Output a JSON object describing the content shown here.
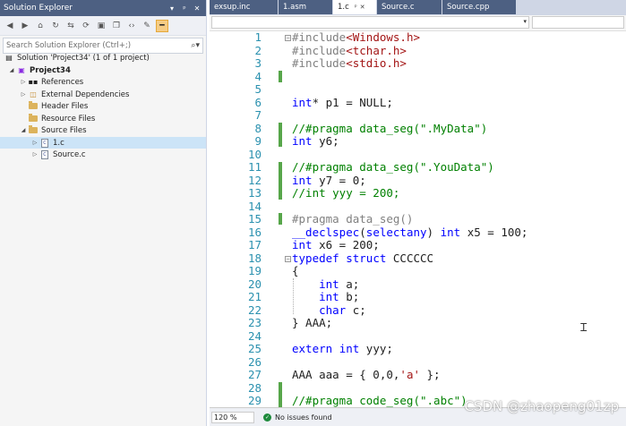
{
  "solution_explorer": {
    "title": "Solution Explorer",
    "title_buttons": [
      "▾",
      "ᵖ",
      "✕"
    ],
    "toolbar_icons": [
      "back-icon",
      "forward-icon",
      "home-icon",
      "sync-icon",
      "switch-views-icon",
      "refresh-icon",
      "collapse-all-icon",
      "show-all-files-icon",
      "view-code-icon",
      "properties-icon",
      "preview-icon"
    ],
    "search_placeholder": "Search Solution Explorer (Ctrl+;)",
    "tree": [
      {
        "label": "Solution 'Project34' (1 of 1 project)",
        "icon": "solution-icon",
        "bold": false
      },
      {
        "label": "Project34",
        "icon": "project-icon",
        "bold": true
      },
      {
        "label": "References",
        "icon": "references-icon",
        "bold": false
      },
      {
        "label": "External Dependencies",
        "icon": "external-dependencies-icon",
        "bold": false
      },
      {
        "label": "Header Files",
        "icon": "folder-icon",
        "bold": false
      },
      {
        "label": "Resource Files",
        "icon": "folder-icon",
        "bold": false
      },
      {
        "label": "Source Files",
        "icon": "folder-icon",
        "bold": false
      },
      {
        "label": "1.c",
        "icon": "c-file-icon",
        "bold": false,
        "selected": true
      },
      {
        "label": "Source.c",
        "icon": "c-file-icon",
        "bold": false
      }
    ]
  },
  "tabs": [
    {
      "label": "exsup.inc",
      "active": false
    },
    {
      "label": "1.asm",
      "active": false
    },
    {
      "label": "1.c",
      "active": true
    },
    {
      "label": "Source.c",
      "active": false
    },
    {
      "label": "Source.cpp",
      "active": false
    }
  ],
  "tab_controls": {
    "pin": "ᵖ",
    "close": "✕"
  },
  "line_numbers": [
    "1",
    "2",
    "3",
    "4",
    "5",
    "6",
    "7",
    "8",
    "9",
    "10",
    "11",
    "12",
    "13",
    "14",
    "15",
    "16",
    "17",
    "18",
    "19",
    "20",
    "21",
    "22",
    "23",
    "24",
    "25",
    "26",
    "27",
    "28",
    "29"
  ],
  "code_lines": [
    "#include<Windows.h>",
    "#include<tchar.h>",
    "#include<stdio.h>",
    "",
    "",
    "int* p1 = NULL;",
    "",
    "//#pragma data_seg(\".MyData\")",
    "int y6;",
    "",
    "//#pragma data_seg(\".YouData\")",
    "int y7 = 0;",
    "//int yyy = 200;",
    "",
    "#pragma data_seg()",
    "__declspec(selectany) int x5 = 100;",
    "int x6 = 200;",
    "typedef struct CCCCCC",
    "{",
    "    int a;",
    "    int b;",
    "    char c;",
    "} AAA;",
    "",
    "extern int yyy;",
    "",
    "AAA aaa = { 0,0,'a' };",
    "",
    "//#pragma code_seg(\".abc\")"
  ],
  "status": {
    "zoom": "120 %",
    "issues": "No issues found"
  },
  "watermark": "CSDN @zhaopeng01zp",
  "colors": {
    "keyword": "#0000ff",
    "preprocessor": "#808080",
    "string": "#a31515",
    "comment": "#008000",
    "line_number": "#2b91af",
    "change_marker": "#57a64a",
    "title_bar": "#4d6082"
  }
}
